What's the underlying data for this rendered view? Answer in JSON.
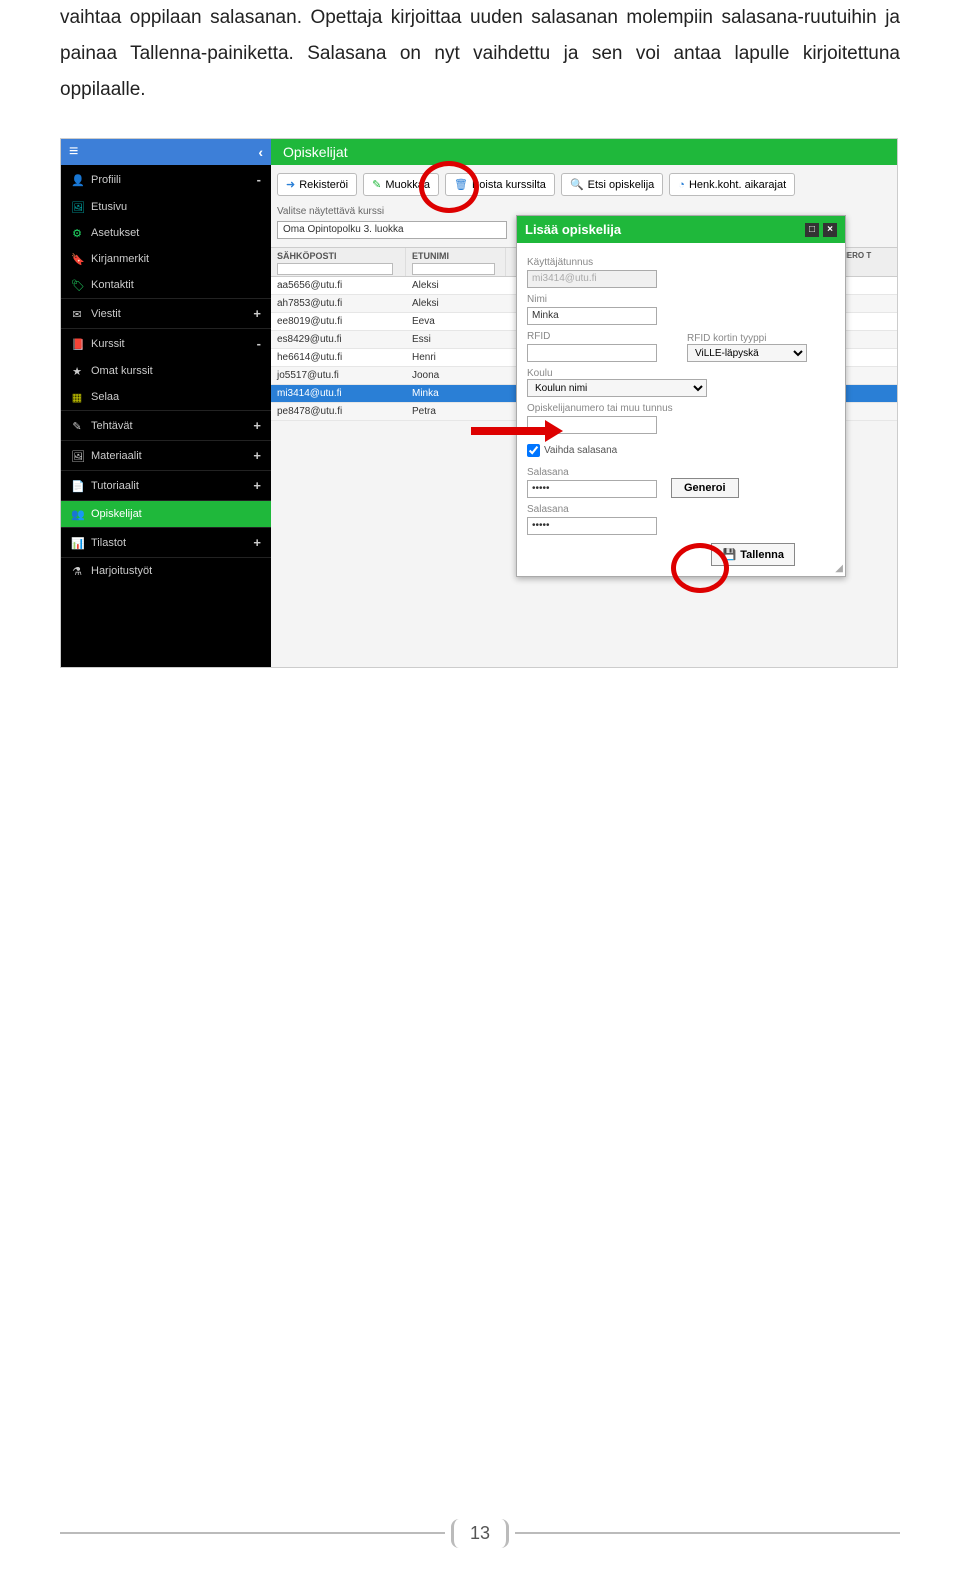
{
  "intro": "vaihtaa oppilaan salasanan. Opettaja kirjoittaa uuden salasanan molempiin salasana-ruutuihin ja painaa Tallenna-painiketta. Salasana on nyt vaihdettu ja sen voi antaa lapulle kirjoitettuna oppilaalle.",
  "header": {
    "title": "Opiskelijat"
  },
  "sidebar": {
    "items": [
      {
        "icon": "👤",
        "label": "Profiili",
        "acc": "-",
        "cls": ""
      },
      {
        "icon": "🖼",
        "label": "Etusivu",
        "acc": "",
        "cls": "teal"
      },
      {
        "icon": "⚙",
        "label": "Asetukset",
        "acc": "",
        "cls": "green"
      },
      {
        "icon": "🔖",
        "label": "Kirjanmerkit",
        "acc": "",
        "cls": "green"
      },
      {
        "icon": "🏷",
        "label": "Kontaktit",
        "acc": "",
        "cls": "green"
      },
      {
        "icon": "✉",
        "label": "Viestit",
        "acc": "+",
        "cls": "",
        "border": true
      },
      {
        "icon": "📕",
        "label": "Kurssit",
        "acc": "-",
        "cls": "",
        "border": true
      },
      {
        "icon": "★",
        "label": "Omat kurssit",
        "acc": "",
        "cls": "star"
      },
      {
        "icon": "▦",
        "label": "Selaa",
        "acc": "",
        "cls": "yellow"
      },
      {
        "icon": "✎",
        "label": "Tehtävät",
        "acc": "+",
        "cls": "",
        "border": true
      },
      {
        "icon": "🖼",
        "label": "Materiaalit",
        "acc": "+",
        "cls": "",
        "border": true
      },
      {
        "icon": "📄",
        "label": "Tutoriaalit",
        "acc": "+",
        "cls": "",
        "border": true
      },
      {
        "icon": "👥",
        "label": "Opiskelijat",
        "acc": "",
        "cls": "",
        "active": true,
        "border": true
      },
      {
        "icon": "📊",
        "label": "Tilastot",
        "acc": "+",
        "cls": "",
        "border": true
      },
      {
        "icon": "⚗",
        "label": "Harjoitustyöt",
        "acc": "",
        "cls": "",
        "border": true
      }
    ]
  },
  "toolbar": {
    "rekisteroi": "Rekisteröi",
    "muokkaa": "Muokkaa",
    "poista": "Poista kurssilta",
    "etsi": "Etsi opiskelija",
    "henk": "Henk.koht. aikarajat"
  },
  "course": {
    "label": "Valitse näytettävä kurssi",
    "value": "Oma Opintopolku 3. luokka"
  },
  "table": {
    "cols": {
      "email": "SÄHKÖPOSTI",
      "name": "ETUNIMI",
      "num": "OPISKELIJANUMERO T"
    },
    "rows": [
      {
        "email": "aa5656@utu.fi",
        "name": "Aleksi"
      },
      {
        "email": "ah7853@utu.fi",
        "name": "Aleksi"
      },
      {
        "email": "ee8019@utu.fi",
        "name": "Eeva"
      },
      {
        "email": "es8429@utu.fi",
        "name": "Essi"
      },
      {
        "email": "he6614@utu.fi",
        "name": "Henri"
      },
      {
        "email": "jo5517@utu.fi",
        "name": "Joona"
      },
      {
        "email": "mi3414@utu.fi",
        "name": "Minka",
        "sel": true
      },
      {
        "email": "pe8478@utu.fi",
        "name": "Petra"
      }
    ]
  },
  "dialog": {
    "title": "Lisää opiskelija",
    "kayttaja_lbl": "Käyttäjätunnus",
    "kayttaja_val": "mi3414@utu.fi",
    "nimi_lbl": "Nimi",
    "nimi_val": "Minka",
    "rfid_lbl": "RFID",
    "rfid_type_lbl": "RFID kortin tyyppi",
    "rfid_type_val": "ViLLE-läpyskä",
    "koulu_lbl": "Koulu",
    "koulu_val": "Koulun nimi",
    "opnum_lbl": "Opiskelijanumero tai muu tunnus",
    "vaihda_lbl": "Vaihda salasana",
    "salasana_lbl": "Salasana",
    "pwd1": "•••••",
    "pwd2": "•••••",
    "generoi": "Generoi",
    "tallenna": "Tallenna"
  },
  "page_number": "13"
}
